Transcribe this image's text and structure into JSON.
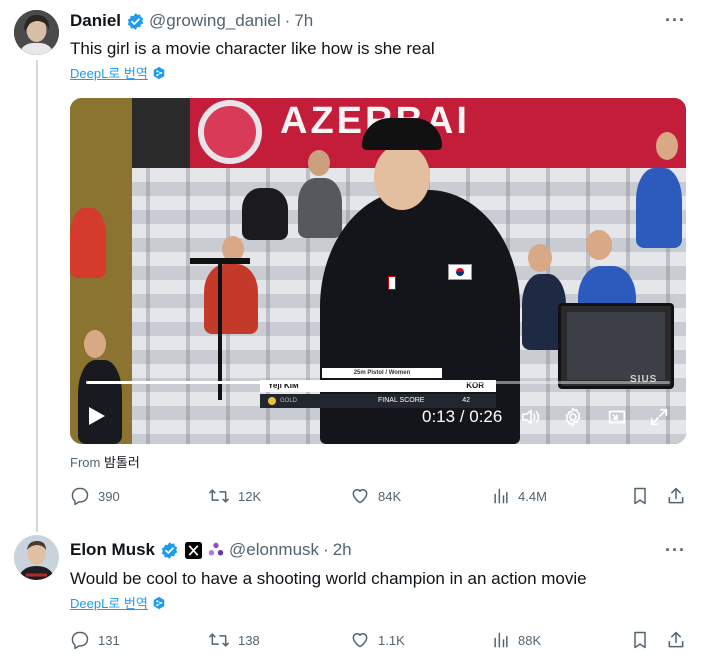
{
  "tweet1": {
    "name": "Daniel",
    "handle": "@growing_daniel",
    "time": "7h",
    "text": "This girl is a movie character like how is she real",
    "translate": "DeepL로 번역",
    "video": {
      "banner": "AZERBAI",
      "event": "25m Pistol / Women",
      "athlete": "Yeji KIM",
      "country": "KOR",
      "medal": "GOLD",
      "score_label": "FINAL SCORE",
      "score": "42",
      "watermark": "SIUS",
      "time": "0:13 / 0:26",
      "progress": 0.5
    },
    "from_label": "From",
    "from_source": "밤톨러",
    "replies": "390",
    "reposts": "12K",
    "likes": "84K",
    "views": "4.4M"
  },
  "tweet2": {
    "name": "Elon Musk",
    "handle": "@elonmusk",
    "time": "2h",
    "text": "Would be cool to have a shooting world champion in an action movie",
    "translate": "DeepL로 번역",
    "replies": "131",
    "reposts": "138",
    "likes": "1.1K",
    "views": "88K"
  },
  "dot": "·",
  "more": "···",
  "colors": {
    "verified": "#1d9bf0",
    "link": "#1d9bf0",
    "muted": "#536471",
    "banner": "#c41d3a"
  }
}
